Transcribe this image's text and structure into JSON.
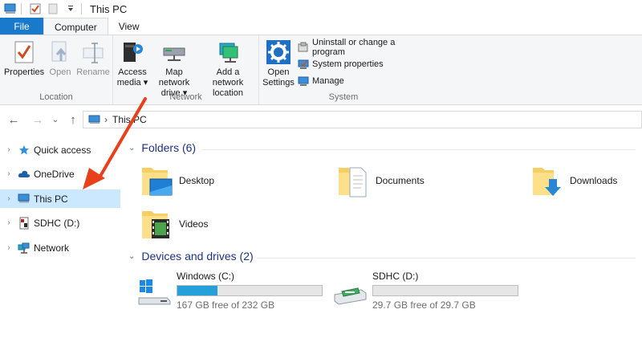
{
  "window": {
    "title": "This PC"
  },
  "tabs": [
    {
      "label": "File"
    },
    {
      "label": "Computer"
    },
    {
      "label": "View"
    }
  ],
  "ribbon": {
    "location": {
      "label": "Location",
      "properties": "Properties",
      "open": "Open",
      "rename": "Rename"
    },
    "network": {
      "label": "Network",
      "access_media_1": "Access",
      "access_media_2": "media",
      "map_drive_1": "Map network",
      "map_drive_2": "drive",
      "add_location_1": "Add a network",
      "add_location_2": "location"
    },
    "system": {
      "label": "System",
      "open_settings_1": "Open",
      "open_settings_2": "Settings",
      "uninstall": "Uninstall or change a program",
      "system_properties": "System properties",
      "manage": "Manage"
    }
  },
  "address": {
    "path": "This PC"
  },
  "nav": {
    "items": [
      {
        "label": "Quick access",
        "icon": "star-icon"
      },
      {
        "label": "OneDrive",
        "icon": "cloud-icon"
      },
      {
        "label": "This PC",
        "icon": "computer-icon"
      },
      {
        "label": "SDHC (D:)",
        "icon": "sd-card-icon"
      },
      {
        "label": "Network",
        "icon": "network-icon"
      }
    ]
  },
  "content": {
    "folders_header": "Folders (6)",
    "folders": [
      {
        "name": "Desktop",
        "icon": "desktop-folder-icon"
      },
      {
        "name": "Documents",
        "icon": "documents-folder-icon"
      },
      {
        "name": "Downloads",
        "icon": "downloads-folder-icon"
      },
      {
        "name": "Videos",
        "icon": "videos-folder-icon"
      }
    ],
    "drives_header": "Devices and drives (2)",
    "drives": [
      {
        "name": "Windows (C:)",
        "free": "167 GB free of 232 GB",
        "used_fraction": 0.28
      },
      {
        "name": "SDHC (D:)",
        "free": "29.7 GB free of 29.7 GB",
        "used_fraction": 0.0
      }
    ]
  },
  "colors": {
    "file_tab": "#1979ca",
    "selection": "#cce8ff",
    "drive_fill": "#26a0da",
    "header_text": "#1e3287",
    "annotation_arrow": "#e8401c"
  }
}
